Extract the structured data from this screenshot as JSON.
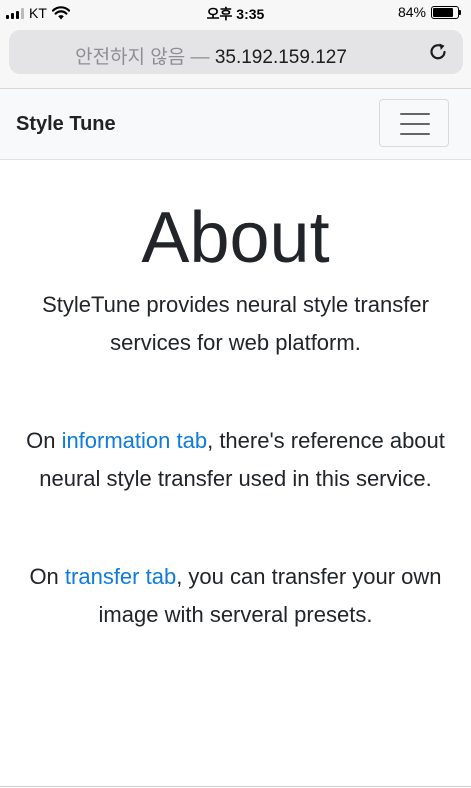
{
  "status_bar": {
    "carrier": "KT",
    "time": "오후 3:35",
    "battery_percent_text": "84%",
    "battery_level": 0.84
  },
  "browser": {
    "insecure_label": "안전하지 않음",
    "separator": "—",
    "host": "35.192.159.127",
    "reload_icon": "reload-icon"
  },
  "navbar": {
    "brand": "Style Tune",
    "toggle_icon": "hamburger-menu-icon"
  },
  "content": {
    "title": "About",
    "intro": "StyleTune provides neural style transfer services for web platform.",
    "info_prefix": "On ",
    "info_link": "information tab",
    "info_suffix": ", there's reference about neural style transfer used in this service.",
    "transfer_prefix": "On ",
    "transfer_link": "transfer tab",
    "transfer_suffix": ", you can transfer your own image with serveral presets."
  },
  "colors": {
    "link": "#0d7be0",
    "navbar_bg": "#f8f9fa",
    "text": "#212529"
  }
}
